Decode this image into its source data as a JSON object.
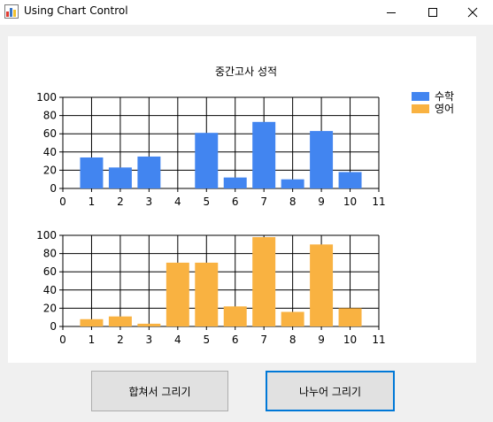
{
  "window": {
    "title": "Using Chart Control"
  },
  "chart": {
    "title": "중간고사 성적",
    "legend": [
      "수학",
      "영어"
    ]
  },
  "buttons": {
    "combined_label": "합쳐서 그리기",
    "split_label": "나누어 그리기"
  },
  "colors": {
    "math": "#4285f0",
    "english": "#f9b241"
  },
  "icons": {
    "app": "chart-app-icon",
    "minimize": "minimize-icon",
    "maximize": "maximize-icon",
    "close": "close-icon"
  },
  "chart_data": [
    {
      "type": "bar",
      "title": "중간고사 성적",
      "x": [
        1,
        2,
        3,
        4,
        5,
        6,
        7,
        8,
        9,
        10
      ],
      "series": [
        {
          "name": "수학",
          "values": [
            34,
            23,
            35,
            0,
            61,
            12,
            73,
            10,
            63,
            18
          ]
        }
      ],
      "xlim": [
        0,
        11
      ],
      "ylim": [
        0,
        100
      ],
      "xticks": [
        "0",
        "1",
        "2",
        "3",
        "4",
        "5",
        "6",
        "7",
        "8",
        "9",
        "10",
        "11"
      ],
      "yticks": [
        "0",
        "20",
        "40",
        "60",
        "80",
        "100"
      ],
      "grid": true,
      "legend": "top-right"
    },
    {
      "type": "bar",
      "x": [
        1,
        2,
        3,
        4,
        5,
        6,
        7,
        8,
        9,
        10
      ],
      "series": [
        {
          "name": "영어",
          "values": [
            8,
            11,
            3,
            70,
            70,
            22,
            98,
            16,
            90,
            20
          ]
        }
      ],
      "xlim": [
        0,
        11
      ],
      "ylim": [
        0,
        100
      ],
      "xticks": [
        "0",
        "1",
        "2",
        "3",
        "4",
        "5",
        "6",
        "7",
        "8",
        "9",
        "10",
        "11"
      ],
      "yticks": [
        "0",
        "20",
        "40",
        "60",
        "80",
        "100"
      ],
      "grid": true
    }
  ]
}
